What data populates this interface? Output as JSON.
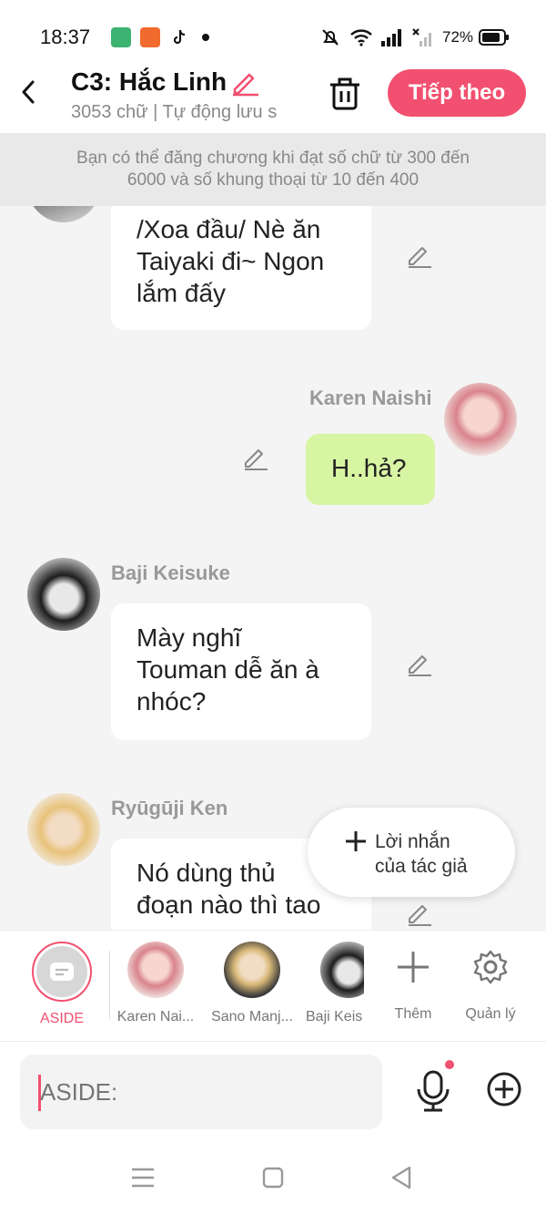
{
  "status_bar": {
    "time": "18:37",
    "battery": "72%"
  },
  "header": {
    "title": "C3: Hắc Linh",
    "subtitle": "3053 chữ | Tự động lưu s",
    "next_label": "Tiếp theo"
  },
  "notice": {
    "line1": "Bạn có thể đăng chương khi đạt số chữ từ 300 đến",
    "line2": "6000 và số khung thoại từ 10 đến 400"
  },
  "messages": [
    {
      "speaker": "",
      "lines": [
        "/Xoa đầu/ Nè ăn",
        "Taiyaki đi~ Ngon",
        "lắm đấy"
      ]
    },
    {
      "speaker": "Karen Naishi",
      "lines": [
        "H..hả?"
      ]
    },
    {
      "speaker": "Baji Keisuke",
      "lines": [
        "Mày nghĩ",
        "Touman dễ ăn à",
        "nhóc?"
      ]
    },
    {
      "speaker": "Ryūgūji Ken",
      "lines": [
        "Nó dùng thủ",
        "đoạn nào thì tao"
      ]
    }
  ],
  "author_note": {
    "line1": "Lời nhắn",
    "line2": "của tác giả"
  },
  "characters": [
    {
      "label": "ASIDE"
    },
    {
      "label": "Karen Nai..."
    },
    {
      "label": "Sano Manj..."
    },
    {
      "label": "Baji Keis"
    },
    {
      "label": "Thêm"
    },
    {
      "label": "Quản lý"
    }
  ],
  "input": {
    "placeholder": "ASIDE:"
  },
  "colors": {
    "accent": "#f25070",
    "green_bubble": "#d8f5a4"
  }
}
